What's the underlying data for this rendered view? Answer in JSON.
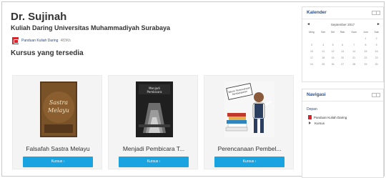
{
  "site": {
    "title": "Dr. Sujinah",
    "subtitle": "Kuliah Daring Universitas Muhammadiyah Surabaya"
  },
  "guide": {
    "label": "Panduan Kuliah Daring",
    "size": "483Kb"
  },
  "courses_heading": "Kursus yang tersedia",
  "courses": [
    {
      "title": "Falsafah Sastra Melayu",
      "button": "Kursus ›",
      "cover_text": "Sastra Melayu"
    },
    {
      "title": "Menjadi Pembicara T...",
      "button": "Kursus ›",
      "cover_text": "Menjadi Pembicara"
    },
    {
      "title": "Perencanaan Pembel...",
      "button": "Kursus ›",
      "cover_text": "Teknik Perencanaan Pembelajaran"
    }
  ],
  "calendar": {
    "title": "Kalender",
    "month": "September 2017",
    "prev": "◄",
    "next": "►",
    "weekdays": [
      "Ming",
      "Sen",
      "Sel",
      "Rab",
      "Kam",
      "Jum",
      "Sab"
    ],
    "weeks": [
      [
        "",
        "",
        "",
        "",
        "",
        "1",
        "2"
      ],
      [
        "3",
        "4",
        "5",
        "6",
        "7",
        "8",
        "9"
      ],
      [
        "10",
        "11",
        "12",
        "13",
        "14",
        "15",
        "16"
      ],
      [
        "17",
        "18",
        "19",
        "20",
        "21",
        "22",
        "23"
      ],
      [
        "24",
        "25",
        "26",
        "27",
        "28",
        "29",
        "30"
      ]
    ]
  },
  "navigation": {
    "title": "Navigasi",
    "home": "Depan",
    "items": [
      "Panduan Kuliah Daring",
      "Kursus"
    ]
  },
  "colors": {
    "accent": "#1aa3e1",
    "link": "#2a4f8a",
    "pdf": "#d8232a"
  }
}
